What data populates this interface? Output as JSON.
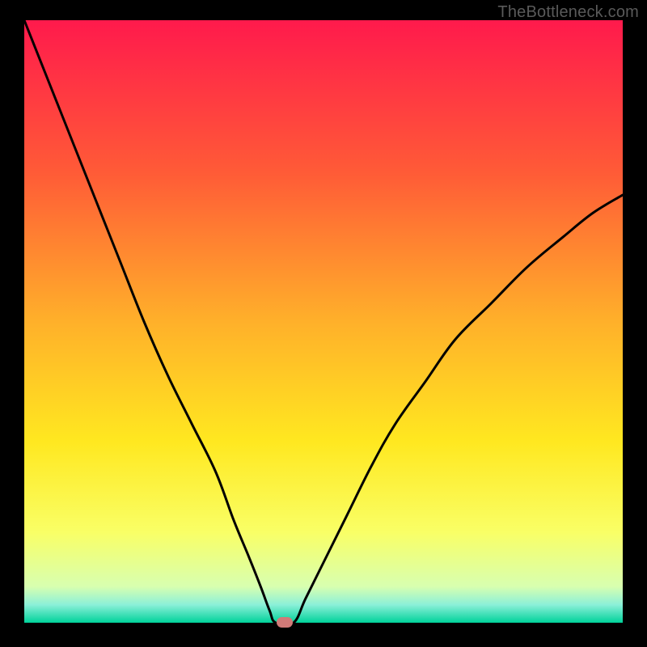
{
  "watermark": "TheBottleneck.com",
  "chart_data": {
    "type": "line",
    "title": "",
    "xlabel": "",
    "ylabel": "",
    "xlim": [
      0,
      100
    ],
    "ylim": [
      0,
      100
    ],
    "grid": false,
    "background_gradient": {
      "stops": [
        {
          "offset": 0,
          "color": "#ff1a4c"
        },
        {
          "offset": 25,
          "color": "#ff5a37"
        },
        {
          "offset": 50,
          "color": "#ffb02a"
        },
        {
          "offset": 70,
          "color": "#ffe820"
        },
        {
          "offset": 85,
          "color": "#f9ff66"
        },
        {
          "offset": 94,
          "color": "#d8ffb0"
        },
        {
          "offset": 97,
          "color": "#8cf0d8"
        },
        {
          "offset": 100,
          "color": "#00d29a"
        }
      ]
    },
    "series": [
      {
        "name": "left-branch",
        "x": [
          0,
          4,
          8,
          12,
          16,
          20,
          24,
          28,
          32,
          35,
          37.5,
          39.5,
          41,
          42
        ],
        "y": [
          100,
          90,
          80,
          70,
          60,
          50,
          41,
          33,
          25,
          17,
          11,
          6,
          2,
          0
        ]
      },
      {
        "name": "valley-floor",
        "x": [
          42,
          45
        ],
        "y": [
          0,
          0
        ]
      },
      {
        "name": "right-branch",
        "x": [
          45,
          47,
          50,
          54,
          58,
          62,
          67,
          72,
          78,
          84,
          90,
          95,
          100
        ],
        "y": [
          0,
          4,
          10,
          18,
          26,
          33,
          40,
          47,
          53,
          59,
          64,
          68,
          71
        ]
      }
    ],
    "marker": {
      "x": 43.5,
      "y": 0,
      "color": "#d17a78"
    }
  }
}
